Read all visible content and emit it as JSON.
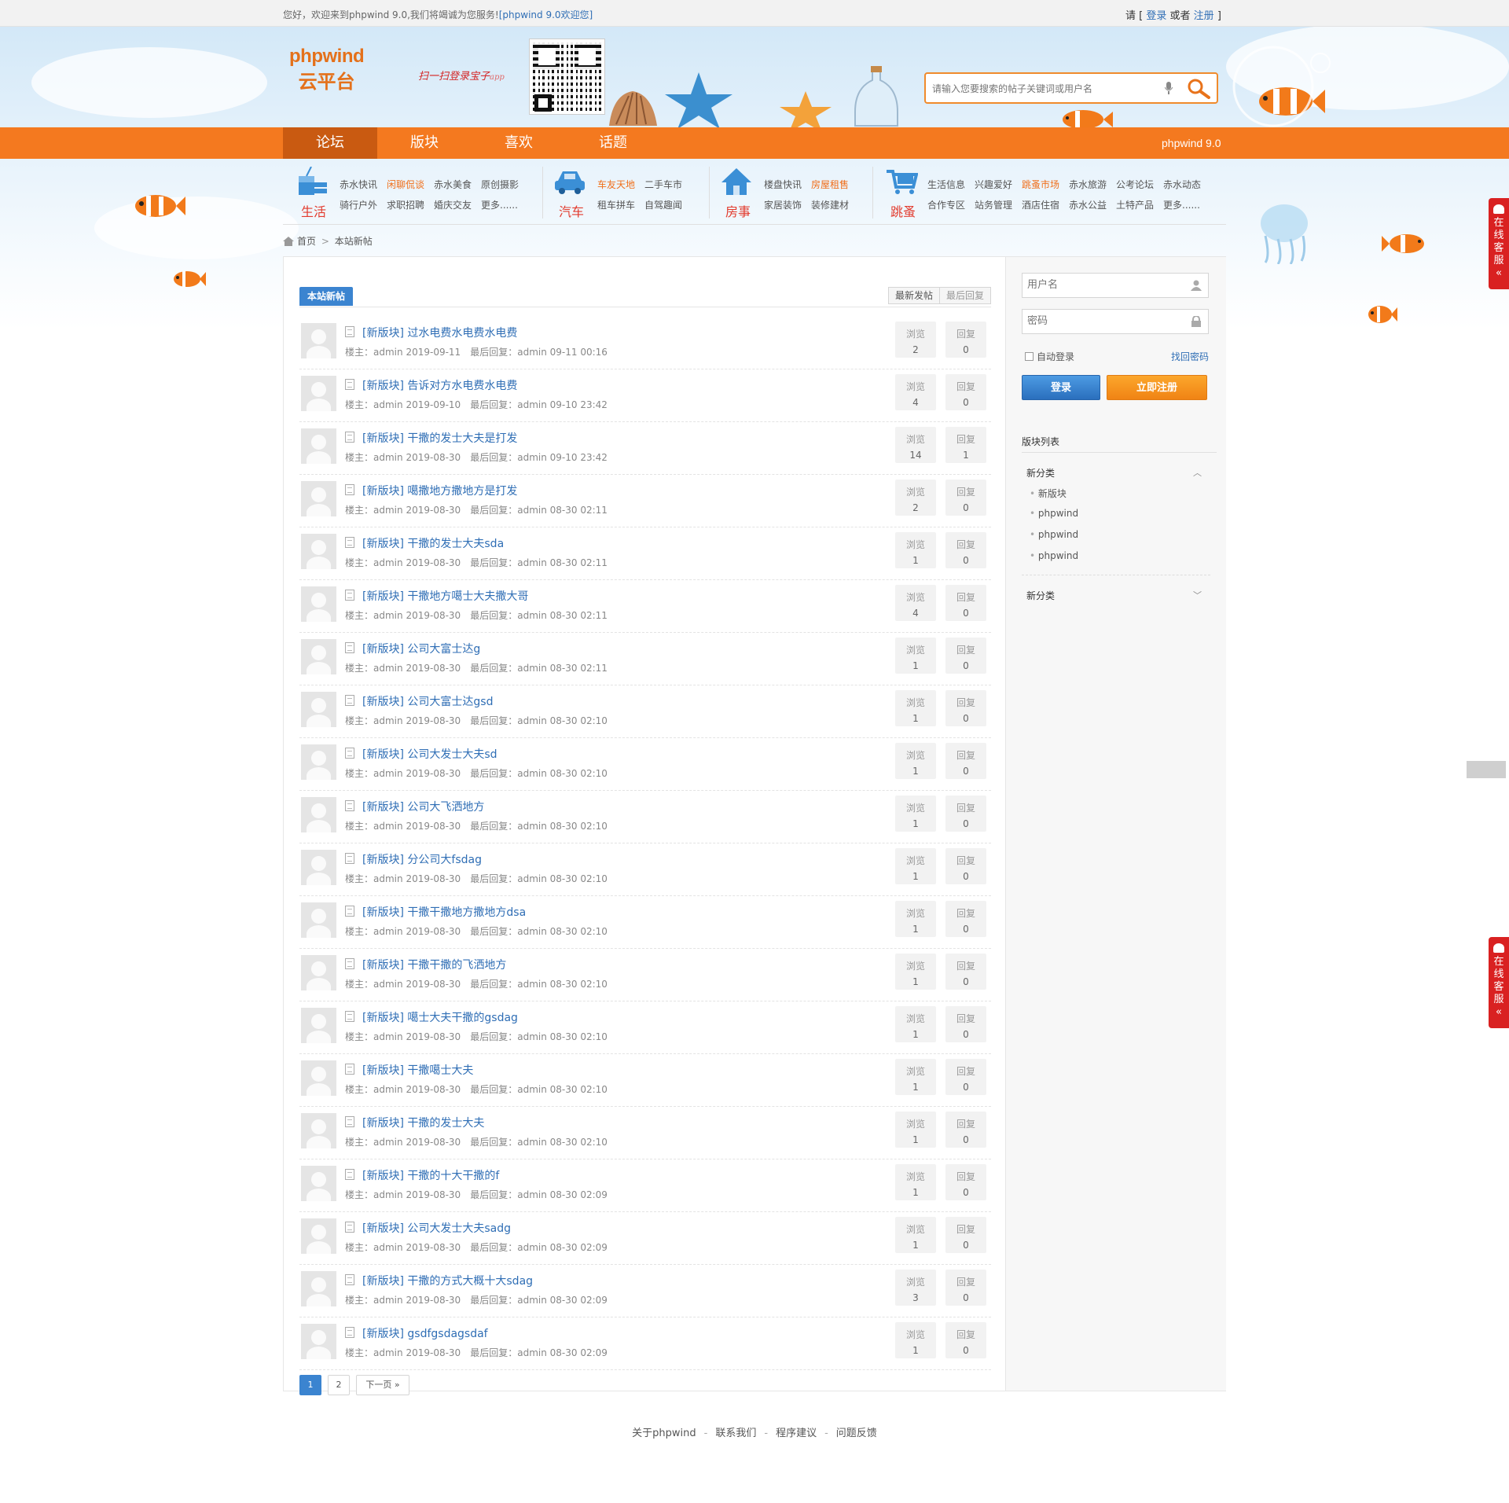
{
  "topbar": {
    "welcome": "您好，欢迎来到phpwind 9.0,我们将竭诚为您服务!",
    "welcome_tag": "[phpwind 9.0欢迎您]",
    "login_prefix": "请 [",
    "login_link": "登录",
    "login_mid": "或者",
    "register_link": "注册",
    "login_suffix": "]"
  },
  "header": {
    "logo_line1": "phpwind",
    "logo_line2": "云平台",
    "scan_text": "扫一扫登录宝子",
    "scan_text_suffix": "app",
    "search_placeholder": "请输入您要搜索的帖子关键词或用户名",
    "colors": {
      "accent": "#f4791f",
      "link": "#2f6eb5"
    }
  },
  "nav": {
    "items": [
      {
        "label": "论坛",
        "active": true
      },
      {
        "label": "版块",
        "active": false
      },
      {
        "label": "喜欢",
        "active": false
      },
      {
        "label": "话题",
        "active": false
      }
    ],
    "version": "phpwind 9.0"
  },
  "categories": [
    {
      "name": "生活",
      "icon": "drink-icon",
      "row1": [
        {
          "t": "赤水快讯"
        },
        {
          "t": "闲聊侃谈",
          "hot": true
        },
        {
          "t": "赤水美食"
        },
        {
          "t": "原创摄影"
        }
      ],
      "row2": [
        {
          "t": "骑行户外"
        },
        {
          "t": "求职招聘"
        },
        {
          "t": "婚庆交友"
        },
        {
          "t": "更多......"
        }
      ]
    },
    {
      "name": "汽车",
      "icon": "car-icon",
      "row1": [
        {
          "t": "车友天地",
          "hot": true
        },
        {
          "t": "二手车市"
        }
      ],
      "row2": [
        {
          "t": "租车拼车"
        },
        {
          "t": "自驾趣闻"
        }
      ]
    },
    {
      "name": "房事",
      "icon": "house-icon",
      "row1": [
        {
          "t": "楼盘快讯"
        },
        {
          "t": "房屋租售",
          "hot": true
        }
      ],
      "row2": [
        {
          "t": "家居装饰"
        },
        {
          "t": "装修建材"
        }
      ]
    },
    {
      "name": "跳蚤",
      "icon": "cart-icon",
      "row1": [
        {
          "t": "生活信息"
        },
        {
          "t": "兴趣爱好"
        },
        {
          "t": "跳蚤市场",
          "hot": true
        },
        {
          "t": "赤水旅游"
        },
        {
          "t": "公考论坛"
        },
        {
          "t": "赤水动态"
        }
      ],
      "row2": [
        {
          "t": "合作专区"
        },
        {
          "t": "站务管理"
        },
        {
          "t": "酒店住宿"
        },
        {
          "t": "赤水公益"
        },
        {
          "t": "土特产品"
        },
        {
          "t": "更多......"
        }
      ]
    }
  ],
  "breadcrumb": {
    "home": "首页",
    "current": "本站新帖"
  },
  "main": {
    "section_label": "本站新帖",
    "sort_tabs": [
      "最新发帖",
      "最后回复"
    ],
    "labels": {
      "views": "浏览",
      "replies": "回复",
      "author_prefix": "楼主：",
      "last_reply_prefix": "最后回复："
    },
    "threads": [
      {
        "tag": "[新版块]",
        "title": "过水电费水电费水电费",
        "author": "admin",
        "date": "2019-09-11",
        "last_user": "admin",
        "last_time": "09-11 00:16",
        "views": 2,
        "replies": 0
      },
      {
        "tag": "[新版块]",
        "title": "告诉对方水电费水电费",
        "author": "admin",
        "date": "2019-09-10",
        "last_user": "admin",
        "last_time": "09-10 23:42",
        "views": 4,
        "replies": 0
      },
      {
        "tag": "[新版块]",
        "title": "干撒的发士大夫是打发",
        "author": "admin",
        "date": "2019-08-30",
        "last_user": "admin",
        "last_time": "09-10 23:42",
        "views": 14,
        "replies": 1
      },
      {
        "tag": "[新版块]",
        "title": "噶撒地方撒地方是打发",
        "author": "admin",
        "date": "2019-08-30",
        "last_user": "admin",
        "last_time": "08-30 02:11",
        "views": 2,
        "replies": 0
      },
      {
        "tag": "[新版块]",
        "title": "干撒的发士大夫sda",
        "author": "admin",
        "date": "2019-08-30",
        "last_user": "admin",
        "last_time": "08-30 02:11",
        "views": 1,
        "replies": 0
      },
      {
        "tag": "[新版块]",
        "title": "干撒地方噶士大夫撒大哥",
        "author": "admin",
        "date": "2019-08-30",
        "last_user": "admin",
        "last_time": "08-30 02:11",
        "views": 4,
        "replies": 0
      },
      {
        "tag": "[新版块]",
        "title": "公司大富士达g",
        "author": "admin",
        "date": "2019-08-30",
        "last_user": "admin",
        "last_time": "08-30 02:11",
        "views": 1,
        "replies": 0
      },
      {
        "tag": "[新版块]",
        "title": "公司大富士达gsd",
        "author": "admin",
        "date": "2019-08-30",
        "last_user": "admin",
        "last_time": "08-30 02:10",
        "views": 1,
        "replies": 0
      },
      {
        "tag": "[新版块]",
        "title": "公司大发士大夫sd",
        "author": "admin",
        "date": "2019-08-30",
        "last_user": "admin",
        "last_time": "08-30 02:10",
        "views": 1,
        "replies": 0
      },
      {
        "tag": "[新版块]",
        "title": "公司大飞洒地方",
        "author": "admin",
        "date": "2019-08-30",
        "last_user": "admin",
        "last_time": "08-30 02:10",
        "views": 1,
        "replies": 0
      },
      {
        "tag": "[新版块]",
        "title": "分公司大fsdag",
        "author": "admin",
        "date": "2019-08-30",
        "last_user": "admin",
        "last_time": "08-30 02:10",
        "views": 1,
        "replies": 0
      },
      {
        "tag": "[新版块]",
        "title": "干撒干撒地方撒地方dsa",
        "author": "admin",
        "date": "2019-08-30",
        "last_user": "admin",
        "last_time": "08-30 02:10",
        "views": 1,
        "replies": 0
      },
      {
        "tag": "[新版块]",
        "title": "干撒干撒的飞洒地方",
        "author": "admin",
        "date": "2019-08-30",
        "last_user": "admin",
        "last_time": "08-30 02:10",
        "views": 1,
        "replies": 0
      },
      {
        "tag": "[新版块]",
        "title": "噶士大夫干撒的gsdag",
        "author": "admin",
        "date": "2019-08-30",
        "last_user": "admin",
        "last_time": "08-30 02:10",
        "views": 1,
        "replies": 0
      },
      {
        "tag": "[新版块]",
        "title": "干撒噶士大夫",
        "author": "admin",
        "date": "2019-08-30",
        "last_user": "admin",
        "last_time": "08-30 02:10",
        "views": 1,
        "replies": 0
      },
      {
        "tag": "[新版块]",
        "title": "干撒的发士大夫",
        "author": "admin",
        "date": "2019-08-30",
        "last_user": "admin",
        "last_time": "08-30 02:10",
        "views": 1,
        "replies": 0
      },
      {
        "tag": "[新版块]",
        "title": "干撒的十大干撒的f",
        "author": "admin",
        "date": "2019-08-30",
        "last_user": "admin",
        "last_time": "08-30 02:09",
        "views": 1,
        "replies": 0
      },
      {
        "tag": "[新版块]",
        "title": "公司大发士大夫sadg",
        "author": "admin",
        "date": "2019-08-30",
        "last_user": "admin",
        "last_time": "08-30 02:09",
        "views": 1,
        "replies": 0
      },
      {
        "tag": "[新版块]",
        "title": "干撒的方式大概十大sdag",
        "author": "admin",
        "date": "2019-08-30",
        "last_user": "admin",
        "last_time": "08-30 02:09",
        "views": 3,
        "replies": 0
      },
      {
        "tag": "[新版块]",
        "title": "gsdfgsdagsdaf",
        "author": "admin",
        "date": "2019-08-30",
        "last_user": "admin",
        "last_time": "08-30 02:09",
        "views": 1,
        "replies": 0
      }
    ],
    "pager": {
      "page1": "1",
      "page2": "2",
      "next": "下一页 »"
    }
  },
  "sidebar": {
    "username_placeholder": "用户名",
    "password_placeholder": "密码",
    "remember": "自动登录",
    "forgot": "找回密码",
    "login_button": "登录",
    "register_button": "立即注册",
    "forum_list_title": "版块列表",
    "group1": {
      "name": "新分类",
      "items": [
        "新版块",
        "phpwind",
        "phpwind",
        "phpwind"
      ]
    },
    "group2": {
      "name": "新分类"
    }
  },
  "footer": {
    "links": [
      "关于phpwind",
      "联系我们",
      "程序建议",
      "问题反馈"
    ]
  },
  "service": {
    "label": "在线客服",
    "arrow": "«"
  }
}
